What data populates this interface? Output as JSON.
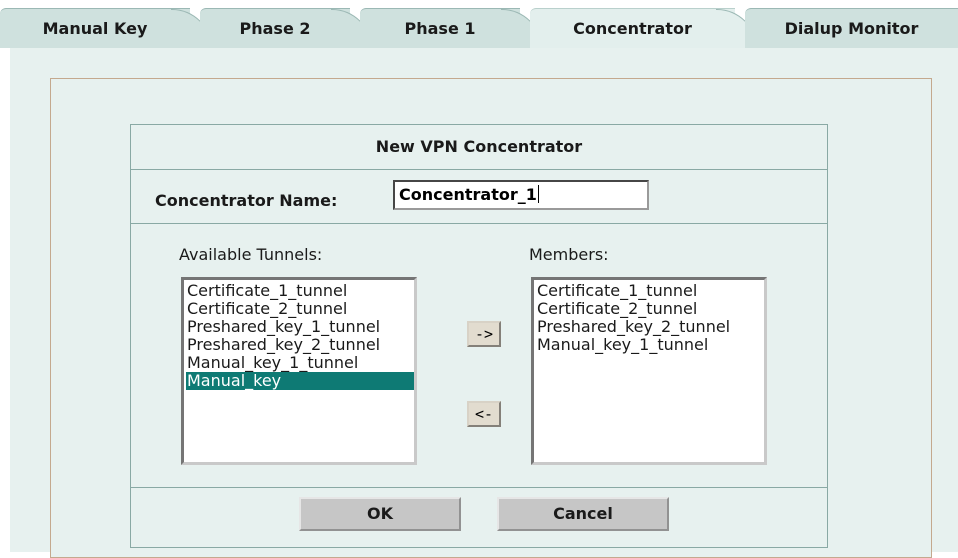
{
  "tabs": [
    {
      "label": "Manual Key",
      "active": false
    },
    {
      "label": "Phase 2",
      "active": false
    },
    {
      "label": "Phase 1",
      "active": false
    },
    {
      "label": "Concentrator",
      "active": true
    },
    {
      "label": "Dialup Monitor",
      "active": false
    }
  ],
  "dialog": {
    "title": "New VPN Concentrator",
    "name_label": "Concentrator Name:",
    "name_value": "Concentrator_1",
    "available_label": "Available Tunnels:",
    "members_label": "Members:",
    "available_items": [
      "Certificate_1_tunnel",
      "Certificate_2_tunnel",
      "Preshared_key_1_tunnel",
      "Preshared_key_2_tunnel",
      "Manual_key_1_tunnel",
      "Manual_key"
    ],
    "available_selected_index": 5,
    "member_items": [
      "Certificate_1_tunnel",
      "Certificate_2_tunnel",
      "Preshared_key_2_tunnel",
      "Manual_key_1_tunnel"
    ],
    "add_label": "->",
    "remove_label": "<-",
    "ok_label": "OK",
    "cancel_label": "Cancel"
  },
  "colors": {
    "panel_bg": "#e7f1ef",
    "tab_bg": "#cfe1de",
    "selection": "#0e7a74",
    "border": "#89a9a4"
  }
}
